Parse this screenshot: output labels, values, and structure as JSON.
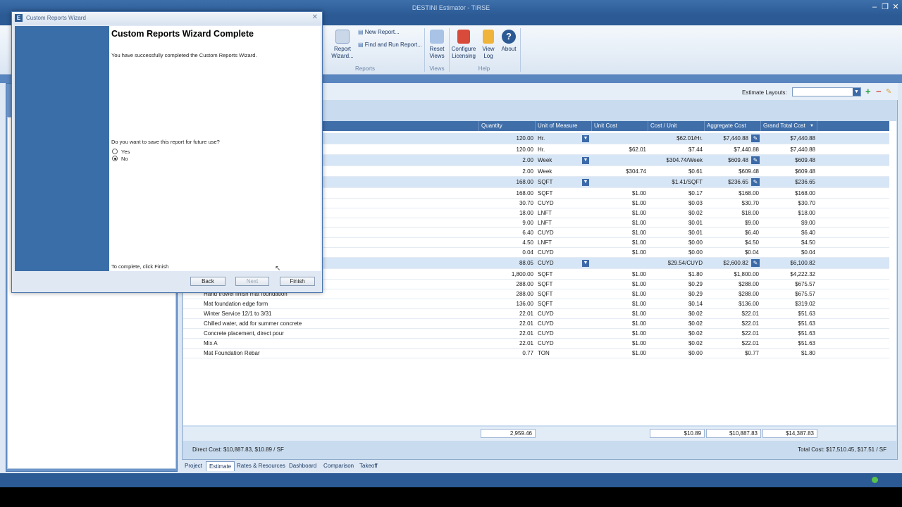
{
  "app": {
    "title": "DESTINI Estimator - TIRSE"
  },
  "ribbon": {
    "report_wizard": "Report\nWizard...",
    "new_report": "New Report...",
    "find_and_run": "Find and Run Report...",
    "reports_group": "Reports",
    "reset_views": "Reset\nViews",
    "views_group": "Views",
    "configure_licensing": "Configure\nLicensing",
    "view_log": "View\nLog",
    "about": "About",
    "help_group": "Help"
  },
  "estimate": {
    "layouts_label": "Estimate Layouts:"
  },
  "grid": {
    "headers": [
      "Quantity",
      "Unit of Measure",
      "Unit Cost",
      "Cost / Unit",
      "Aggregate Cost",
      "Grand Total Cost"
    ],
    "rows": [
      {
        "name": "",
        "qty": "120.00",
        "uom": "Hr.",
        "uc": "",
        "cpu": "$62.01/Hr.",
        "agg": "$7,440.88",
        "gt": "$7,440.88",
        "group": true
      },
      {
        "name": "",
        "qty": "120.00",
        "uom": "Hr.",
        "uc": "$62.01",
        "cpu": "$7.44",
        "agg": "$7,440.88",
        "gt": "$7,440.88",
        "group": false
      },
      {
        "name": "",
        "qty": "2.00",
        "uom": "Week",
        "uc": "",
        "cpu": "$304.74/Week",
        "agg": "$609.48",
        "gt": "$609.48",
        "group": true
      },
      {
        "name": "",
        "qty": "2.00",
        "uom": "Week",
        "uc": "$304.74",
        "cpu": "$0.61",
        "agg": "$609.48",
        "gt": "$609.48",
        "group": false
      },
      {
        "name": "",
        "qty": "168.00",
        "uom": "SQFT",
        "uc": "",
        "cpu": "$1.41/SQFT",
        "agg": "$236.65",
        "gt": "$236.65",
        "group": true
      },
      {
        "name": "",
        "qty": "168.00",
        "uom": "SQFT",
        "uc": "$1.00",
        "cpu": "$0.17",
        "agg": "$168.00",
        "gt": "$168.00",
        "group": false
      },
      {
        "name": "",
        "qty": "30.70",
        "uom": "CUYD",
        "uc": "$1.00",
        "cpu": "$0.03",
        "agg": "$30.70",
        "gt": "$30.70",
        "group": false
      },
      {
        "name": "",
        "qty": "18.00",
        "uom": "LNFT",
        "uc": "$1.00",
        "cpu": "$0.02",
        "agg": "$18.00",
        "gt": "$18.00",
        "group": false
      },
      {
        "name": "",
        "qty": "9.00",
        "uom": "LNFT",
        "uc": "$1.00",
        "cpu": "$0.01",
        "agg": "$9.00",
        "gt": "$9.00",
        "group": false
      },
      {
        "name": "",
        "qty": "6.40",
        "uom": "CUYD",
        "uc": "$1.00",
        "cpu": "$0.01",
        "agg": "$6.40",
        "gt": "$6.40",
        "group": false
      },
      {
        "name": "",
        "qty": "4.50",
        "uom": "LNFT",
        "uc": "$1.00",
        "cpu": "$0.00",
        "agg": "$4.50",
        "gt": "$4.50",
        "group": false
      },
      {
        "name": "",
        "qty": "0.04",
        "uom": "CUYD",
        "uc": "$1.00",
        "cpu": "$0.00",
        "agg": "$0.04",
        "gt": "$0.04",
        "group": false
      },
      {
        "name": "",
        "qty": "88.05",
        "uom": "CUYD",
        "uc": "",
        "cpu": "$29.54/CUYD",
        "agg": "$2,600.82",
        "gt": "$6,100.82",
        "group": true
      },
      {
        "name": "",
        "qty": "1,800.00",
        "uom": "SQFT",
        "uc": "$1.00",
        "cpu": "$1.80",
        "agg": "$1,800.00",
        "gt": "$4,222.32",
        "group": false
      },
      {
        "name": "",
        "qty": "288.00",
        "uom": "SQFT",
        "uc": "$1.00",
        "cpu": "$0.29",
        "agg": "$288.00",
        "gt": "$675.57",
        "group": false
      },
      {
        "name": "Hand trowel finish mat foundation",
        "qty": "288.00",
        "uom": "SQFT",
        "uc": "$1.00",
        "cpu": "$0.29",
        "agg": "$288.00",
        "gt": "$675.57",
        "group": false
      },
      {
        "name": "Mat foundation edge form",
        "qty": "136.00",
        "uom": "SQFT",
        "uc": "$1.00",
        "cpu": "$0.14",
        "agg": "$136.00",
        "gt": "$319.02",
        "group": false
      },
      {
        "name": "Winter Service 12/1 to 3/31",
        "qty": "22.01",
        "uom": "CUYD",
        "uc": "$1.00",
        "cpu": "$0.02",
        "agg": "$22.01",
        "gt": "$51.63",
        "group": false
      },
      {
        "name": "Chilled water, add for summer concrete",
        "qty": "22.01",
        "uom": "CUYD",
        "uc": "$1.00",
        "cpu": "$0.02",
        "agg": "$22.01",
        "gt": "$51.63",
        "group": false
      },
      {
        "name": "Concrete placement, direct pour",
        "qty": "22.01",
        "uom": "CUYD",
        "uc": "$1.00",
        "cpu": "$0.02",
        "agg": "$22.01",
        "gt": "$51.63",
        "group": false
      },
      {
        "name": "Mix A",
        "qty": "22.01",
        "uom": "CUYD",
        "uc": "$1.00",
        "cpu": "$0.02",
        "agg": "$22.01",
        "gt": "$51.63",
        "group": false
      },
      {
        "name": "Mat Foundation Rebar",
        "qty": "0.77",
        "uom": "TON",
        "uc": "$1.00",
        "cpu": "$0.00",
        "agg": "$0.77",
        "gt": "$1.80",
        "group": false
      }
    ],
    "totals": {
      "qty": "2,959.46",
      "cpu": "$10.89",
      "agg": "$10,887.83",
      "gt": "$14,387.83"
    }
  },
  "status": {
    "direct_cost": "Direct Cost: $10,887.83, $10.89 / SF",
    "total_cost": "Total Cost: $17,510.45, $17.51 / SF"
  },
  "tabs": [
    "Project",
    "Estimate",
    "Rates & Resources",
    "Dashboard",
    "Comparison",
    "Takeoff"
  ],
  "dialog": {
    "title": "Custom Reports Wizard",
    "heading": "Custom Reports Wizard Complete",
    "message": "You have successfully completed the Custom Reports Wizard.",
    "question": "Do you want to save this report for future use?",
    "yes": "Yes",
    "no": "No",
    "footer_note": "To complete, click Finish",
    "back": "Back",
    "next": "Next",
    "finish": "Finish"
  },
  "colors": {
    "accent": "#2b5a94",
    "header": "#3f6ea9",
    "group_row": "#d7e6f6"
  }
}
